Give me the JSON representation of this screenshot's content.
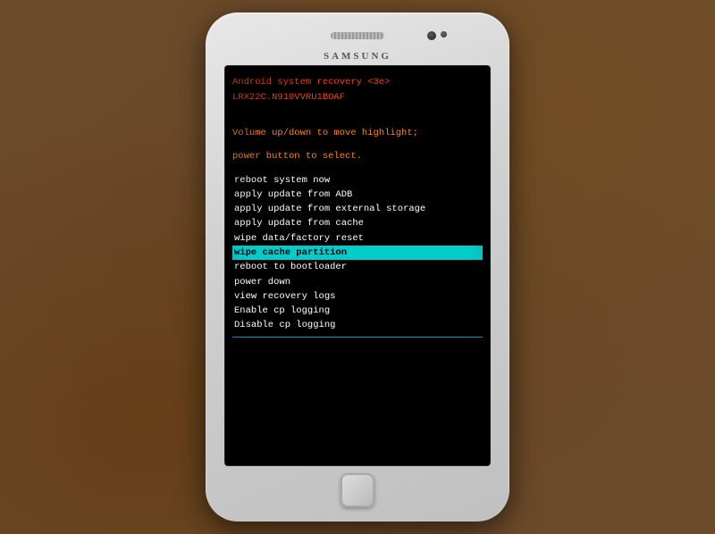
{
  "phone": {
    "brand": "SAMSUNG"
  },
  "screen": {
    "header": {
      "title": "Android system recovery <3e>",
      "subtitle": "LRX22C.N910VVRU1BOAF"
    },
    "instructions": {
      "line1": "Volume up/down to move highlight;",
      "line2": "power button to select."
    },
    "menu": {
      "items": [
        {
          "id": "reboot-system",
          "label": "reboot system now",
          "selected": false
        },
        {
          "id": "apply-adb",
          "label": "apply update from ADB",
          "selected": false
        },
        {
          "id": "apply-external",
          "label": "apply update from external storage",
          "selected": false
        },
        {
          "id": "apply-cache",
          "label": "apply update from cache",
          "selected": false
        },
        {
          "id": "wipe-data",
          "label": "wipe data/factory reset",
          "selected": false
        },
        {
          "id": "wipe-cache",
          "label": "wipe cache partition",
          "selected": true
        },
        {
          "id": "reboot-bootloader",
          "label": "reboot to bootloader",
          "selected": false
        },
        {
          "id": "power-down",
          "label": "power down",
          "selected": false
        },
        {
          "id": "view-logs",
          "label": "view recovery logs",
          "selected": false
        },
        {
          "id": "enable-cp",
          "label": "Enable cp logging",
          "selected": false
        },
        {
          "id": "disable-cp",
          "label": "Disable cp logging",
          "selected": false
        }
      ]
    }
  }
}
